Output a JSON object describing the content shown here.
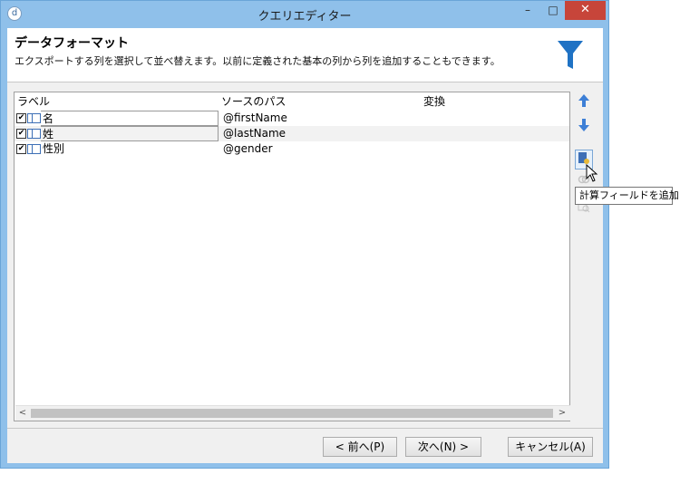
{
  "window": {
    "title": "クエリエディター",
    "app_icon": "d",
    "min_glyph": "–",
    "max_glyph": "□",
    "close_glyph": "✕"
  },
  "header": {
    "title": "データフォーマット",
    "description": "エクスポートする列を選択して並べ替えます。以前に定義された基本の列から列を追加することもできます。",
    "icon": "funnel-icon",
    "icon_color": "#1f72c4"
  },
  "grid": {
    "columns": [
      "ラベル",
      "ソースのパス",
      "変換"
    ],
    "rows": [
      {
        "checked": true,
        "label": "名",
        "source": "@firstName",
        "transform": ""
      },
      {
        "checked": true,
        "label": "姓",
        "source": "@lastName",
        "transform": ""
      },
      {
        "checked": true,
        "label": "性別",
        "source": "@gender",
        "transform": ""
      }
    ]
  },
  "side_toolbar": {
    "items": [
      "move-up-icon",
      "move-down-icon",
      "add-computed-field-icon",
      "link-icon",
      "search-doc-icon"
    ],
    "tooltip": "計算フィールドを追加"
  },
  "buttons": {
    "prev": "< 前へ(P)",
    "next": "次へ(N) >",
    "cancel": "キャンセル(A)"
  },
  "colors": {
    "accent": "#3d6fb6",
    "title_bar": "#8fc0ea",
    "close": "#c7453a"
  }
}
